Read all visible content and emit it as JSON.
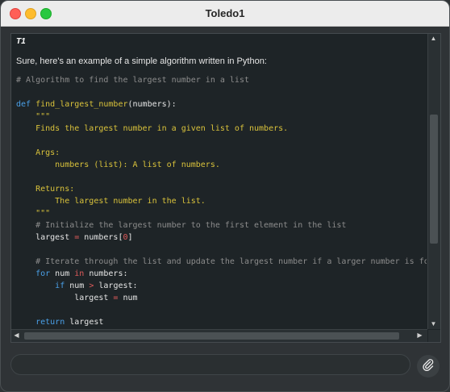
{
  "window": {
    "title": "Toledo1"
  },
  "chat": {
    "speaker": "T1",
    "intro": "Sure, here's an example of a simple algorithm written in Python:",
    "code_lines": [
      [
        {
          "t": "# Algorithm to find the largest number in a list",
          "c": "cm"
        }
      ],
      [],
      [
        {
          "t": "def",
          "c": "kw"
        },
        {
          "t": " ",
          "c": ""
        },
        {
          "t": "find_largest_number",
          "c": "fn"
        },
        {
          "t": "(numbers):",
          "c": ""
        }
      ],
      [
        {
          "t": "    \"\"\"",
          "c": "doc"
        }
      ],
      [
        {
          "t": "    Finds the largest number in a given list of numbers.",
          "c": "doc"
        }
      ],
      [],
      [
        {
          "t": "    Args:",
          "c": "doc"
        }
      ],
      [
        {
          "t": "        numbers (list): A list of numbers.",
          "c": "doc"
        }
      ],
      [],
      [
        {
          "t": "    Returns:",
          "c": "doc"
        }
      ],
      [
        {
          "t": "        The largest number in the list.",
          "c": "doc"
        }
      ],
      [
        {
          "t": "    \"\"\"",
          "c": "doc"
        }
      ],
      [
        {
          "t": "    # Initialize the largest number to the first element in the list",
          "c": "cm"
        }
      ],
      [
        {
          "t": "    largest ",
          "c": ""
        },
        {
          "t": "=",
          "c": "op"
        },
        {
          "t": " numbers[",
          "c": ""
        },
        {
          "t": "0",
          "c": "num"
        },
        {
          "t": "]",
          "c": ""
        }
      ],
      [],
      [
        {
          "t": "    # Iterate through the list and update the largest number if a larger number is found",
          "c": "cm"
        }
      ],
      [
        {
          "t": "    ",
          "c": ""
        },
        {
          "t": "for",
          "c": "kw"
        },
        {
          "t": " num ",
          "c": ""
        },
        {
          "t": "in",
          "c": "op"
        },
        {
          "t": " numbers:",
          "c": ""
        }
      ],
      [
        {
          "t": "        ",
          "c": ""
        },
        {
          "t": "if",
          "c": "kw"
        },
        {
          "t": " num ",
          "c": ""
        },
        {
          "t": ">",
          "c": "op"
        },
        {
          "t": " largest:",
          "c": ""
        }
      ],
      [
        {
          "t": "            largest ",
          "c": ""
        },
        {
          "t": "=",
          "c": "op"
        },
        {
          "t": " num",
          "c": ""
        }
      ],
      [],
      [
        {
          "t": "    ",
          "c": ""
        },
        {
          "t": "return",
          "c": "kw"
        },
        {
          "t": " largest",
          "c": ""
        }
      ]
    ]
  },
  "composer": {
    "value": "",
    "placeholder": ""
  },
  "icons": {
    "attach": "paperclip-icon",
    "scroll_up": "arrow-up-icon",
    "scroll_down": "arrow-down-icon",
    "scroll_left": "arrow-left-icon",
    "scroll_right": "arrow-right-icon"
  },
  "colors": {
    "keyword": "#4aa0e8",
    "function": "#d9c23b",
    "docstring": "#d9c23b",
    "comment": "#8c8c8c",
    "operator": "#e15b5b",
    "panel_bg": "#1e2427"
  }
}
